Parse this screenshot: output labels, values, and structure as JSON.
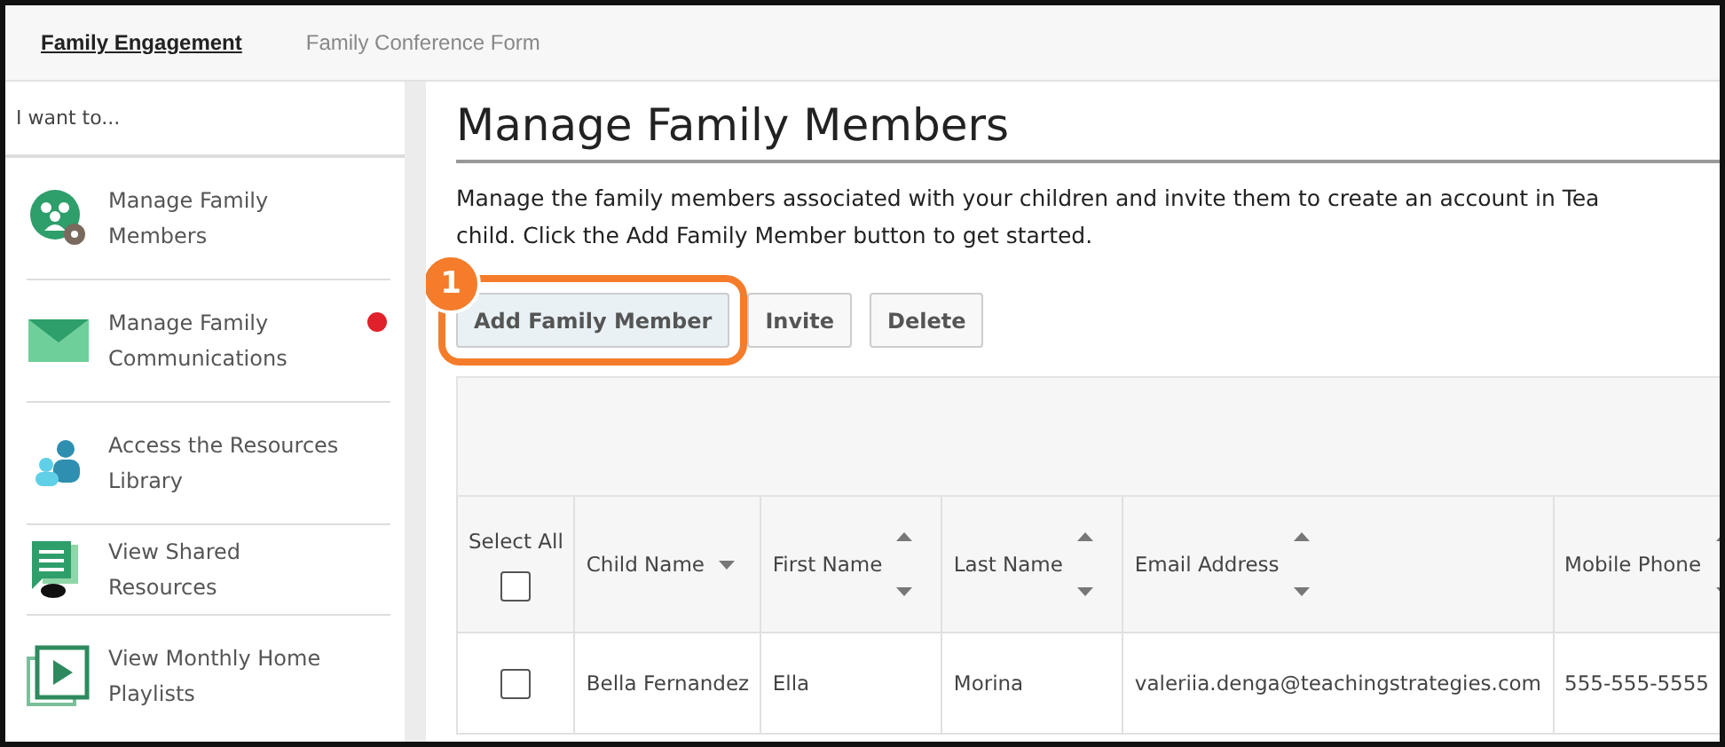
{
  "tabs": [
    {
      "label": "Family Engagement",
      "selected": true
    },
    {
      "label": "Family Conference Form",
      "selected": false
    }
  ],
  "sidebar": {
    "header": "I want to...",
    "items": [
      {
        "kind": "members",
        "label": "Manage Family Members",
        "notify": false
      },
      {
        "kind": "mail",
        "label": "Manage Family Communications",
        "notify": true
      },
      {
        "kind": "library",
        "label": "Access the Resources Library",
        "notify": false
      },
      {
        "kind": "shared",
        "label": "View Shared Resources",
        "notify": false
      },
      {
        "kind": "playlist",
        "label": "View Monthly Home Playlists",
        "notify": false
      }
    ]
  },
  "page": {
    "title": "Manage Family Members",
    "description_lines": [
      "Manage the family members associated with your children and invite them to create an account in Tea",
      "child. Click the Add Family Member button to get started."
    ],
    "callout": {
      "number": "1"
    },
    "buttons": [
      {
        "label": "Add Family Member",
        "highlighted": true
      },
      {
        "label": "Invite",
        "highlighted": false
      },
      {
        "label": "Delete",
        "highlighted": false
      }
    ]
  },
  "table": {
    "select_all": {
      "label": "Select All",
      "checked": false
    },
    "columns": [
      {
        "label": "Child Name",
        "kind": "dropdown"
      },
      {
        "label": "First Name",
        "kind": "sort"
      },
      {
        "label": "Last Name",
        "kind": "sort"
      },
      {
        "label": "Email Address",
        "kind": "sort"
      },
      {
        "label": "Mobile Phone",
        "kind": "sort"
      }
    ],
    "rows": [
      {
        "checked": false,
        "cells": [
          "Bella Fernandez",
          "Ella",
          "Morina",
          "valeriia.denga@teachingstrategies.com",
          "555-555-5555"
        ]
      }
    ]
  }
}
